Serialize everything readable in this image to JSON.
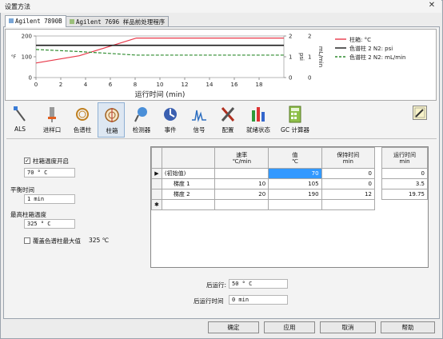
{
  "window": {
    "title": "设置方法",
    "close_glyph": "✕"
  },
  "tabs": [
    {
      "label": "Agilent 7890B",
      "active": true
    },
    {
      "label": "Agilent 7696 样品前处理程序",
      "active": false
    }
  ],
  "chart_data": {
    "type": "line",
    "xlabel": "运行时间 (min)",
    "x_ticks": [
      "0",
      "2",
      "4",
      "6",
      "8",
      "10",
      "12",
      "14",
      "16",
      "18"
    ],
    "xlim": [
      0,
      20
    ],
    "left_axis": {
      "ticks": [
        "200",
        "100",
        "0"
      ],
      "ylim": [
        0,
        200
      ]
    },
    "right_axis_1": {
      "label": "psi",
      "ticks": [
        "2",
        "1",
        "0"
      ]
    },
    "right_axis_2": {
      "label": "mL/min",
      "ticks": [
        "2",
        "1",
        "0"
      ]
    },
    "series": [
      {
        "name": "柱箱: °C",
        "color": "#e8394a",
        "x": [
          0,
          3.5,
          8.1,
          20
        ],
        "y": [
          70,
          105,
          190,
          190
        ]
      },
      {
        "name": "色谱柱 2 N2: psi",
        "color": "#1a1a1a",
        "x": [
          0,
          20
        ],
        "y": [
          1.55,
          1.55
        ]
      },
      {
        "name": "色谱柱 2 N2: mL/min",
        "color": "#2e8b2e",
        "x": [
          0,
          3.5,
          8.1,
          20
        ],
        "y": [
          1.35,
          1.25,
          1.08,
          1.08
        ]
      }
    ]
  },
  "toolbar": {
    "items": [
      {
        "label": "ALS"
      },
      {
        "label": "进样口"
      },
      {
        "label": "色谱柱"
      },
      {
        "label": "柱箱",
        "selected": true
      },
      {
        "label": "检测器"
      },
      {
        "label": "事件"
      },
      {
        "label": "信号"
      },
      {
        "label": "配置"
      },
      {
        "label": "就绪状态"
      },
      {
        "label": "GC 计算器"
      }
    ]
  },
  "left_panel": {
    "oven_on_label": "柱箱温度开启",
    "oven_on_checked": "✓",
    "oven_temp": "70 ° C",
    "equil_label": "平衡时间",
    "equil_value": "1 min",
    "max_label": "最高柱箱温度",
    "max_value": "325 ° C",
    "override_label": "覆盖色谱柱最大值",
    "override_value": "325 ℃"
  },
  "table": {
    "headers": {
      "rate": "速率",
      "rate_unit": "℃/min",
      "value": "值",
      "value_unit": "℃",
      "hold": "保持时间",
      "hold_unit": "min",
      "run": "运行时间",
      "run_unit": "min"
    },
    "rows": [
      {
        "marker": "▶",
        "label": "(初始值)",
        "rate": "",
        "value": "70",
        "hold": "0",
        "run": "0"
      },
      {
        "marker": "",
        "label": "梯度 1",
        "rate": "10",
        "value": "105",
        "hold": "0",
        "run": "3.5"
      },
      {
        "marker": "",
        "label": "梯度 2",
        "rate": "20",
        "value": "190",
        "hold": "12",
        "run": "19.75"
      },
      {
        "marker": "✱",
        "label": "",
        "rate": "",
        "value": "",
        "hold": "",
        "run": ""
      }
    ]
  },
  "post_run": {
    "post_label": "后运行:",
    "post_value": "50 ° C",
    "post_time_label": "后运行时间",
    "post_time_value": "0 min"
  },
  "buttons": {
    "ok": "确定",
    "apply": "应用",
    "cancel": "取消",
    "help": "帮助"
  }
}
